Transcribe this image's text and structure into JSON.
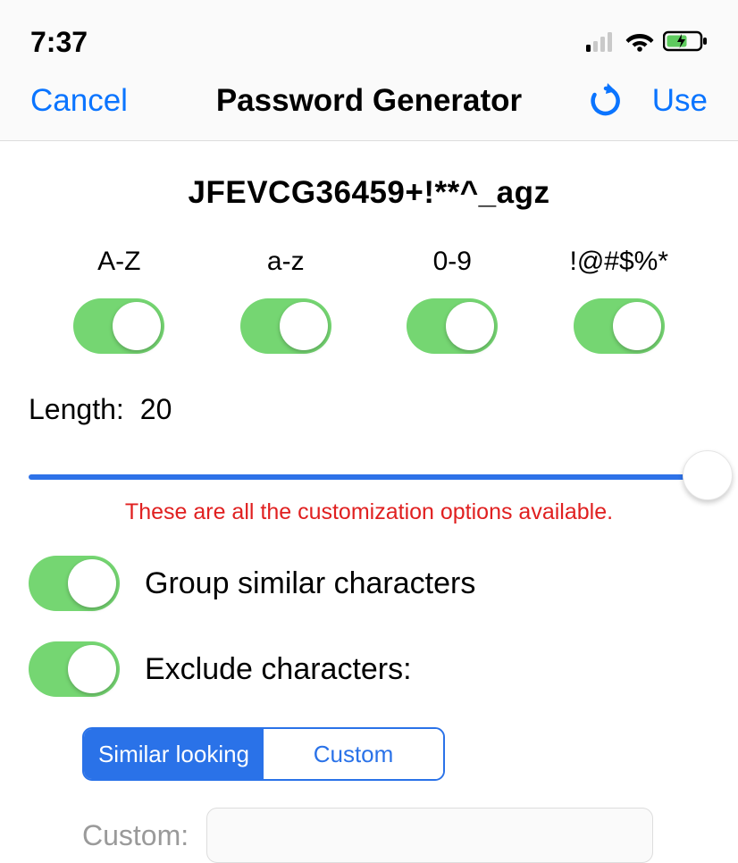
{
  "status": {
    "time": "7:37"
  },
  "nav": {
    "cancel_label": "Cancel",
    "title": "Password Generator",
    "use_label": "Use"
  },
  "generated_password": "JFEVCG36459+!**^_agz",
  "char_classes": [
    {
      "label": "A-Z",
      "enabled": true
    },
    {
      "label": "a-z",
      "enabled": true
    },
    {
      "label": "0-9",
      "enabled": true
    },
    {
      "label": "!@#$%*",
      "enabled": true
    }
  ],
  "length": {
    "label": "Length:",
    "value": "20"
  },
  "hint": "These are all the customization options available.",
  "options": {
    "group_label": "Group similar characters",
    "group_enabled": true,
    "exclude_label": "Exclude characters:",
    "exclude_enabled": true
  },
  "segmented": {
    "similar_label": "Similar looking",
    "custom_label": "Custom",
    "active": "similar"
  },
  "custom": {
    "label": "Custom:",
    "placeholder": ""
  }
}
